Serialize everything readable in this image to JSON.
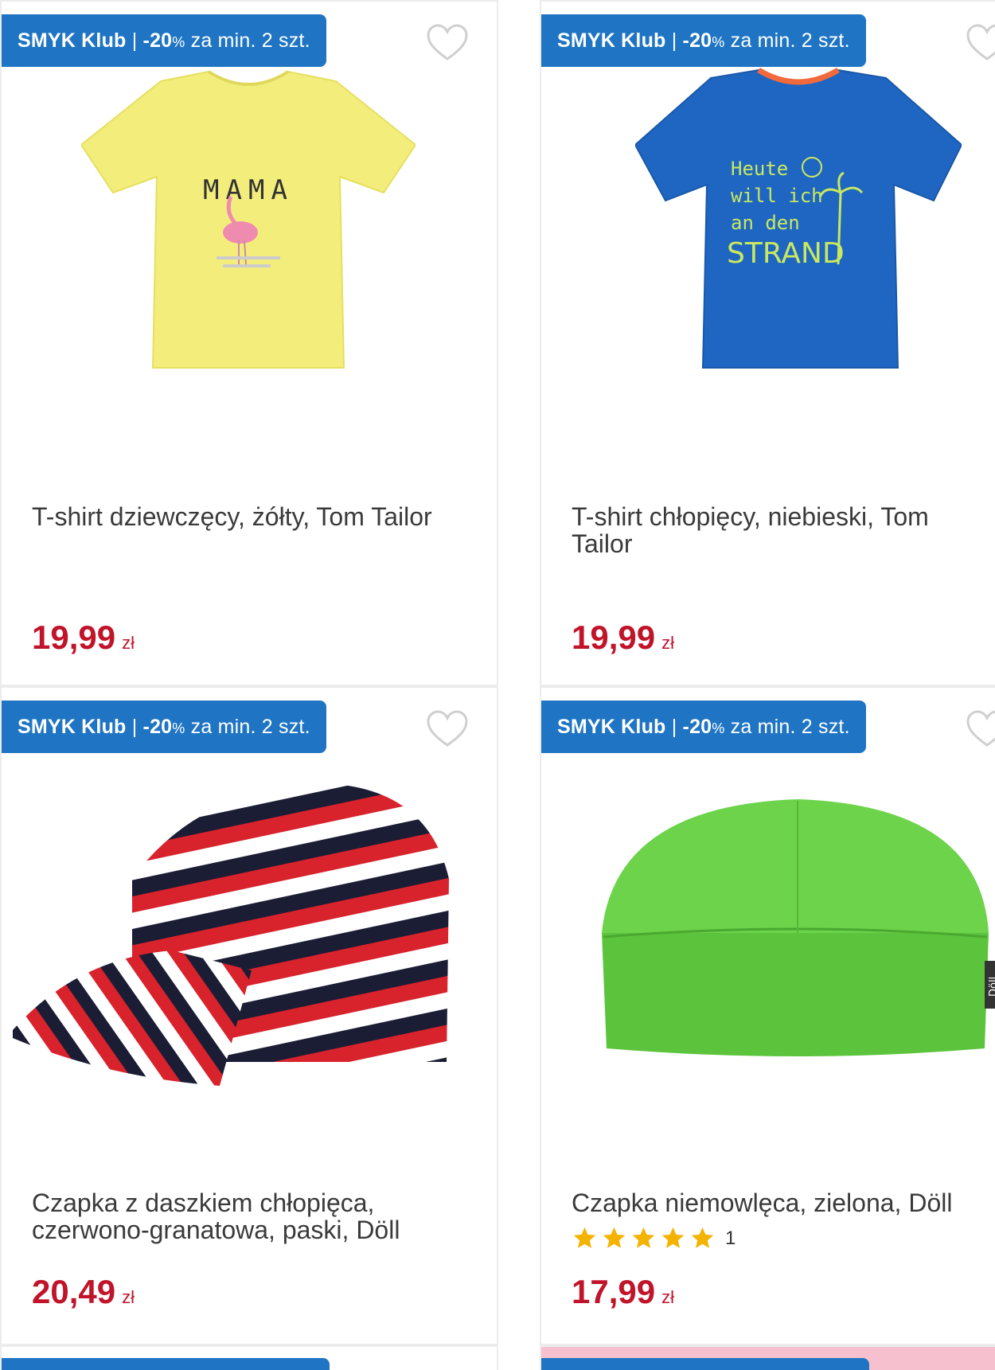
{
  "badge": {
    "brand": "SMYK Klub",
    "separator": "|",
    "discount": "-20",
    "percent": "%",
    "condition": "za min. 2 szt."
  },
  "products": [
    {
      "name": "T-shirt dziewczęcy, żółty, Tom Tailor",
      "price": "19,99",
      "currency": "zł",
      "image": "yellow-tshirt-mama-flamingo",
      "print_text": "MAMA"
    },
    {
      "name": "T-shirt chłopięcy, niebieski, Tom Tailor",
      "price": "19,99",
      "currency": "zł",
      "image": "blue-tshirt-strand",
      "print_lines": [
        "Heute",
        "will ich",
        "an den",
        "STRAND"
      ]
    },
    {
      "name": "Czapka z daszkiem chłopięca, czerwono-granatowa, paski, Döll",
      "price": "20,49",
      "currency": "zł",
      "image": "striped-cap"
    },
    {
      "name": "Czapka niemowlęca, zielona, Döll",
      "price": "17,99",
      "currency": "zł",
      "image": "green-beanie",
      "rating": {
        "stars": 5,
        "count": "1"
      },
      "tag_text": "Döll"
    }
  ],
  "colors": {
    "badge": "#1f75c4",
    "price": "#c0142a",
    "star": "#f5b301"
  }
}
